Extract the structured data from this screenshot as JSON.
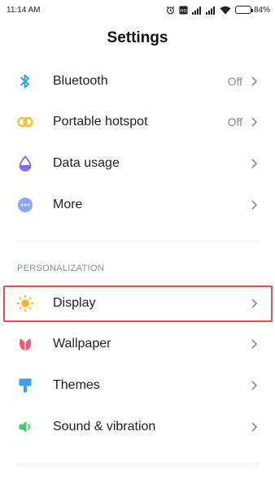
{
  "status_bar": {
    "time": "11:14 AM",
    "battery_percent": "84%",
    "battery_level": 0.84,
    "icons": [
      "alarm-icon",
      "volte-icon",
      "signal-icon",
      "signal-icon",
      "wifi-icon",
      "battery-icon"
    ]
  },
  "header": {
    "title": "Settings"
  },
  "connectivity": {
    "items": [
      {
        "label": "Bluetooth",
        "value": "Off",
        "icon": "bluetooth-icon"
      },
      {
        "label": "Portable hotspot",
        "value": "Off",
        "icon": "hotspot-icon"
      },
      {
        "label": "Data usage",
        "icon": "data-usage-icon"
      },
      {
        "label": "More",
        "icon": "more-icon"
      }
    ]
  },
  "personalization": {
    "header": "PERSONALIZATION",
    "items": [
      {
        "label": "Display",
        "icon": "display-icon",
        "highlighted": true
      },
      {
        "label": "Wallpaper",
        "icon": "wallpaper-icon"
      },
      {
        "label": "Themes",
        "icon": "themes-icon"
      },
      {
        "label": "Sound & vibration",
        "icon": "sound-icon"
      }
    ]
  },
  "colors": {
    "bluetooth": "#2ba6e8",
    "hotspot": "#f2c12e",
    "data_usage": "#7c6cf0",
    "more": "#8ba7f5",
    "display": "#f7b52b",
    "wallpaper": "#f2587a",
    "themes": "#3a9ef2",
    "sound": "#3ecb74",
    "highlight_border": "#d9534f"
  }
}
